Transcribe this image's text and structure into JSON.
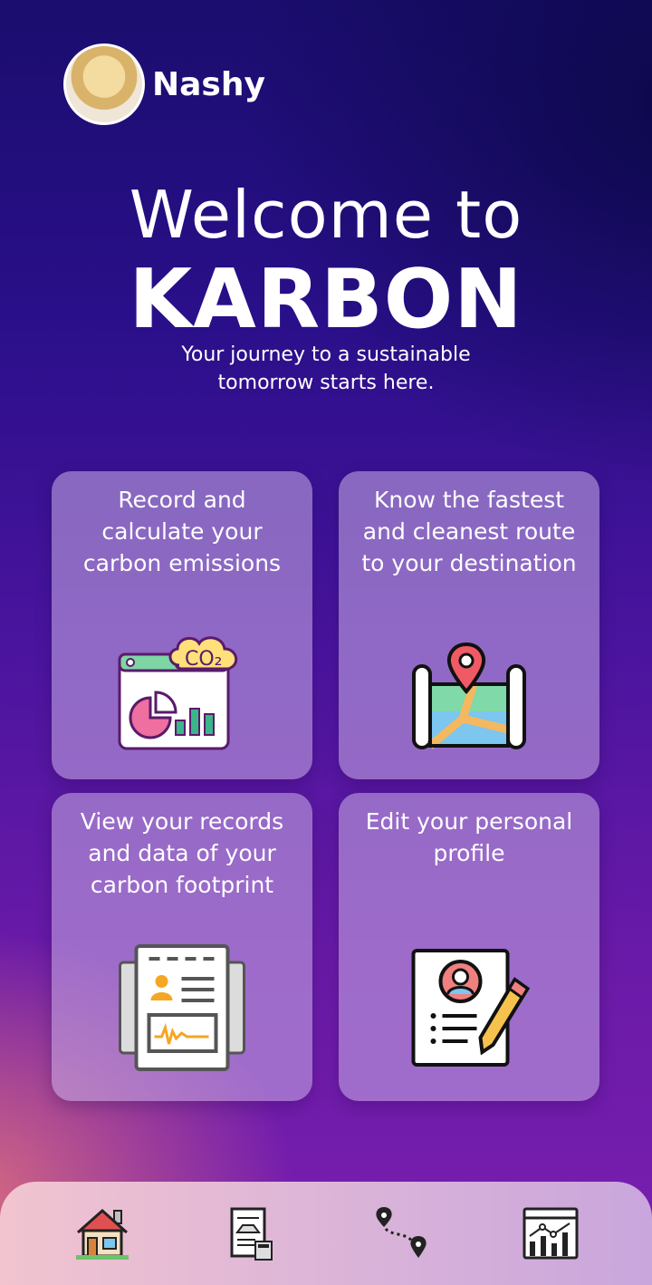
{
  "user": {
    "name": "Nashy"
  },
  "hero": {
    "welcome": "Welcome to",
    "brand": "KARBON",
    "tagline_line1": "Your journey to a sustainable",
    "tagline_line2": "tomorrow starts here."
  },
  "cards": [
    {
      "label": "Record and calculate your carbon emissions",
      "icon": "co2-report-icon"
    },
    {
      "label": "Know the fastest and cleanest route to your destination",
      "icon": "map-route-icon"
    },
    {
      "label": "View your records and data of your carbon footprint",
      "icon": "records-document-icon"
    },
    {
      "label": "Edit your personal profile",
      "icon": "profile-edit-icon"
    }
  ],
  "nav": [
    {
      "name": "home",
      "icon": "home-icon"
    },
    {
      "name": "calculator",
      "icon": "calculator-icon"
    },
    {
      "name": "route",
      "icon": "route-icon"
    },
    {
      "name": "analytics",
      "icon": "analytics-icon"
    }
  ],
  "colors": {
    "card_bg": "#c8afe6",
    "nav_bg_start": "#f2c4cf",
    "nav_bg_end": "#c9a6dc"
  }
}
